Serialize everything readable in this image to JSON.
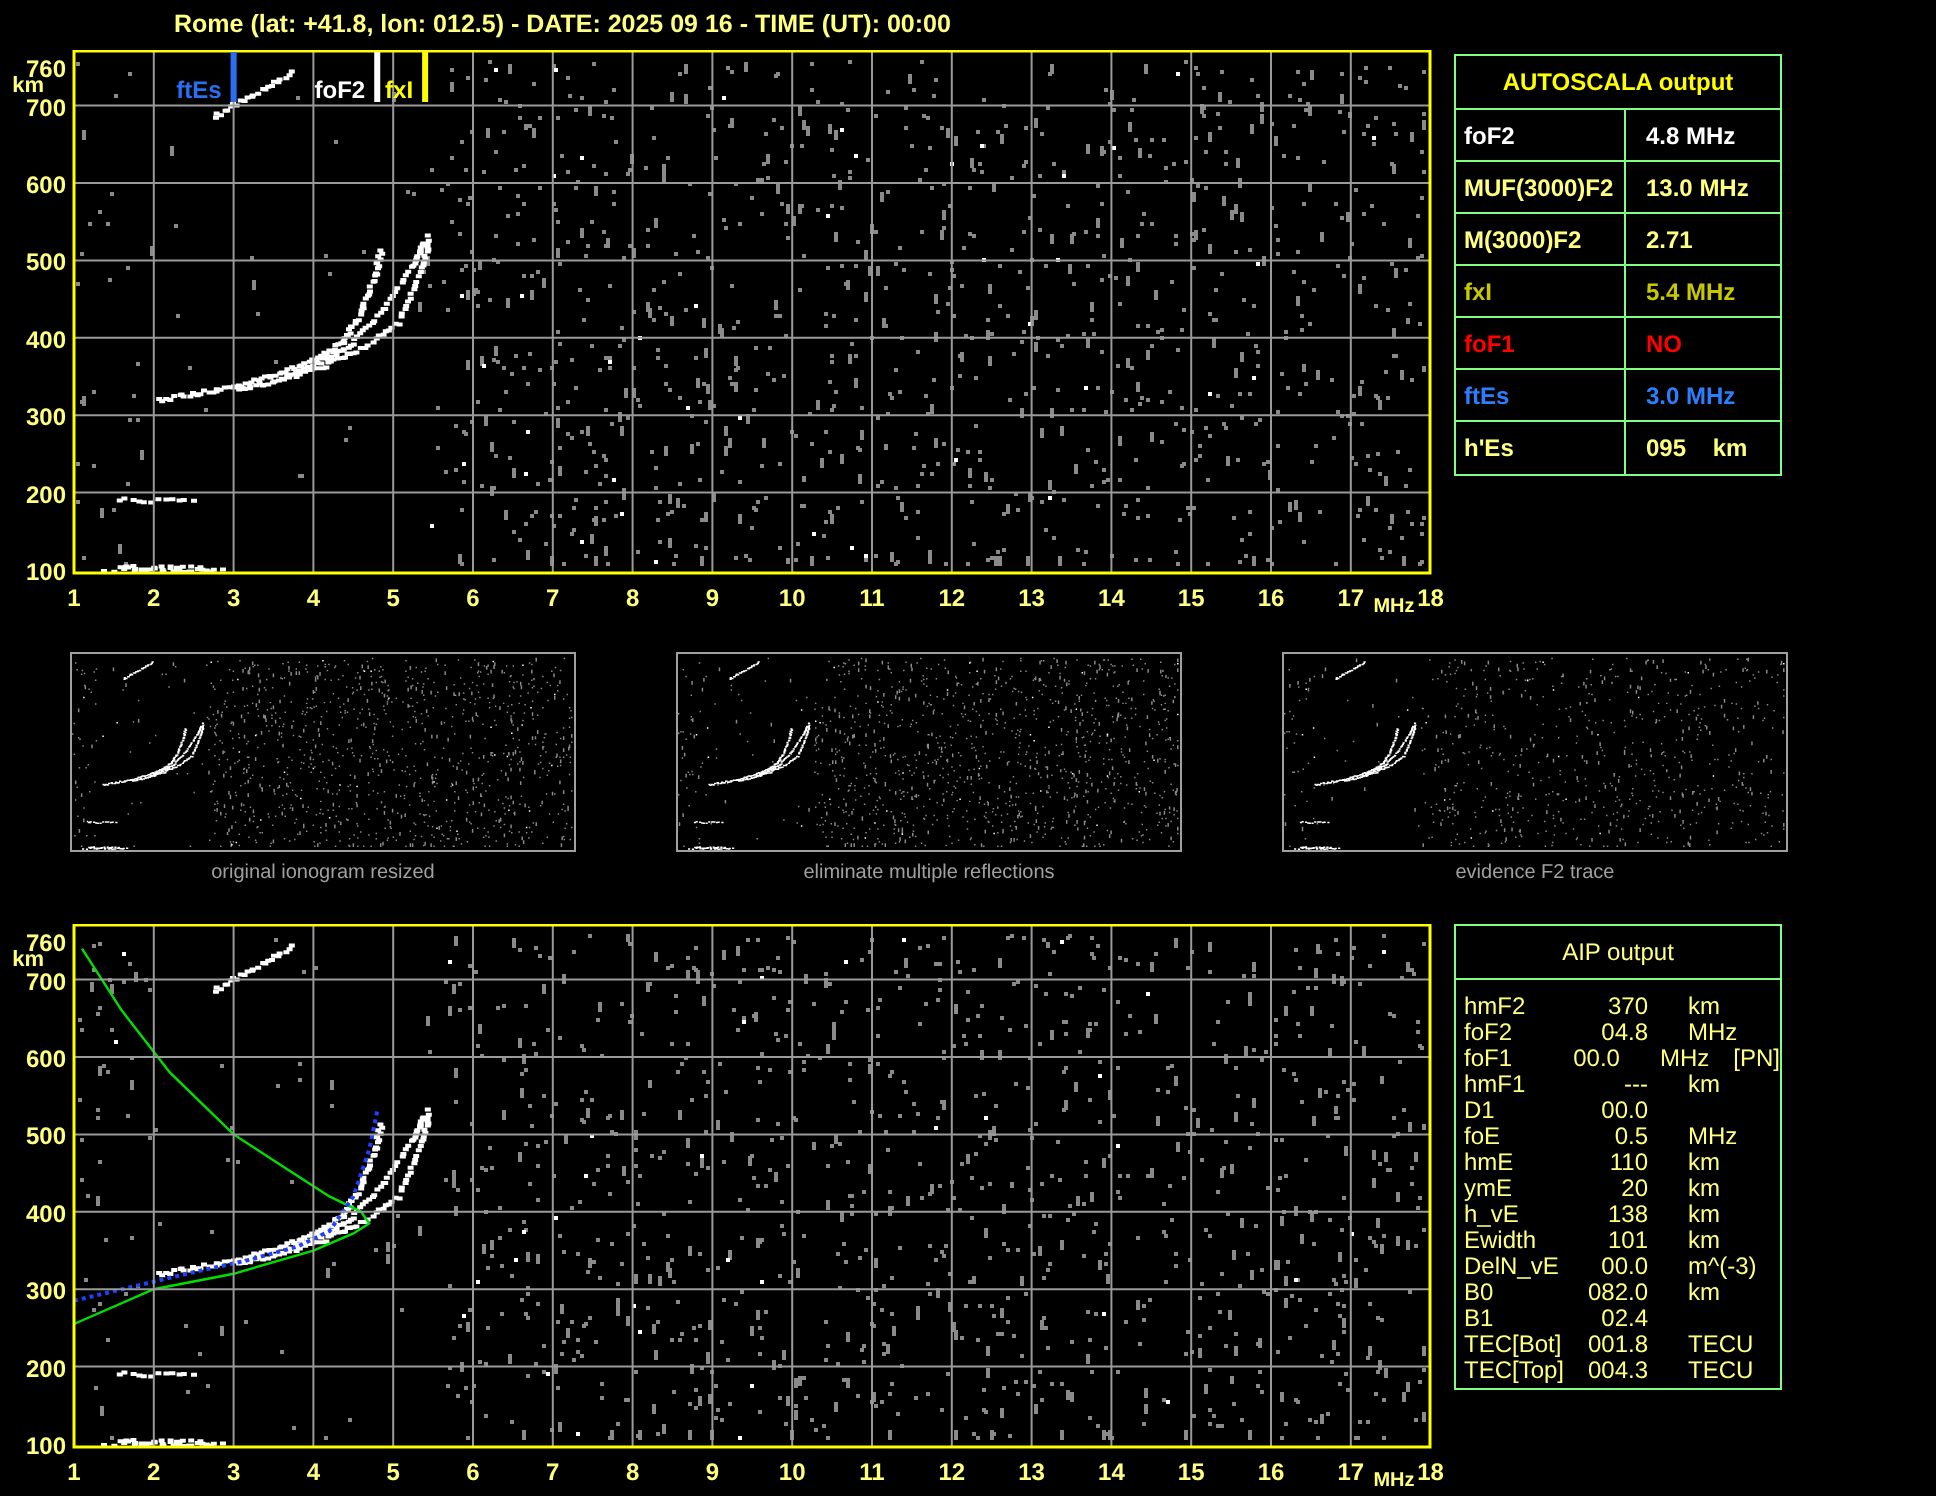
{
  "title": "Rome (lat: +41.8, lon: 012.5) - DATE: 2025 09 16 - TIME (UT): 00:00",
  "top_plot": {
    "y_labels": [
      "760",
      "700",
      "600",
      "500",
      "400",
      "300",
      "200",
      "100"
    ],
    "y_unit": "km",
    "x_labels": [
      "1",
      "2",
      "3",
      "4",
      "5",
      "6",
      "7",
      "8",
      "9",
      "10",
      "11",
      "12",
      "13",
      "14",
      "15",
      "16",
      "17",
      "18"
    ],
    "x_unit": "MHz",
    "markers": [
      {
        "label": "ftEs",
        "color": "#2a6ff0"
      },
      {
        "label": "foF2",
        "color": "#ffffff"
      },
      {
        "label": "fxI",
        "color": "#ffff00"
      }
    ]
  },
  "autoscala": {
    "title": "AUTOSCALA output",
    "rows": [
      {
        "name": "foF2",
        "value": "4.8 MHz",
        "color": "#ffffff"
      },
      {
        "name": "MUF(3000)F2",
        "value": "13.0 MHz",
        "color": "#ffff80"
      },
      {
        "name": "M(3000)F2",
        "value": "2.71",
        "color": "#ffff80"
      },
      {
        "name": "fxI",
        "value": "5.4 MHz",
        "color": "#c8c800"
      },
      {
        "name": "foF1",
        "value": "NO",
        "color": "#ff0000"
      },
      {
        "name": "ftEs",
        "value": "3.0 MHz",
        "color": "#2a7fff"
      },
      {
        "name": "h'Es",
        "value": "095    km",
        "color": "#ffff80"
      }
    ]
  },
  "thumbnails": [
    {
      "caption": "original ionogram resized"
    },
    {
      "caption": "eliminate multiple reflections"
    },
    {
      "caption": "evidence F2 trace"
    }
  ],
  "bottom_plot": {
    "y_labels": [
      "760",
      "700",
      "600",
      "500",
      "400",
      "300",
      "200",
      "100"
    ],
    "y_unit": "km",
    "x_labels": [
      "1",
      "2",
      "3",
      "4",
      "5",
      "6",
      "7",
      "8",
      "9",
      "10",
      "11",
      "12",
      "13",
      "14",
      "15",
      "16",
      "17",
      "18"
    ],
    "x_unit": "MHz"
  },
  "aip": {
    "title": "AIP output",
    "rows": [
      {
        "name": "hmF2",
        "value": "370",
        "unit": "km"
      },
      {
        "name": "foF2",
        "value": "04.8",
        "unit": "MHz"
      },
      {
        "name": "foF1",
        "value": "00.0",
        "unit": "MHz",
        "note": "[PN]"
      },
      {
        "name": "hmF1",
        "value": "---",
        "unit": "km"
      },
      {
        "name": "D1",
        "value": "00.0"
      },
      {
        "name": "foE",
        "value": "0.5",
        "unit": "MHz"
      },
      {
        "name": "hmE",
        "value": "110",
        "unit": "km"
      },
      {
        "name": "ymE",
        "value": "20",
        "unit": "km"
      },
      {
        "name": "h_vE",
        "value": "138",
        "unit": "km"
      },
      {
        "name": "Ewidth",
        "value": "101",
        "unit": "km"
      },
      {
        "name": "DelN_vE",
        "value": "00.0",
        "unit": "m^(-3)"
      },
      {
        "name": "B0",
        "value": "082.0",
        "unit": "km"
      },
      {
        "name": "B1",
        "value": "02.4"
      },
      {
        "name": "TEC[Bot]",
        "value": "001.8",
        "unit": "TECU"
      },
      {
        "name": "TEC[Top]",
        "value": "004.3",
        "unit": "TECU"
      }
    ]
  }
}
